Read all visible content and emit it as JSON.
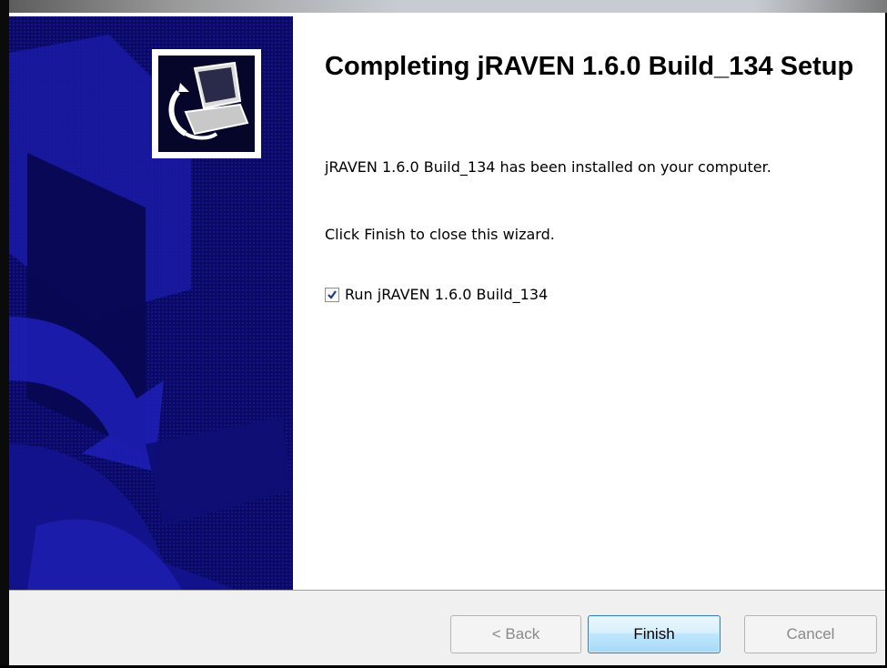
{
  "wizard": {
    "title": "Completing jRAVEN 1.6.0 Build_134 Setup",
    "installed_message": "jRAVEN 1.6.0 Build_134 has been installed on your computer.",
    "close_instruction": "Click Finish to close this wizard.",
    "run_checkbox": {
      "label": "Run jRAVEN 1.6.0 Build_134",
      "checked": true
    }
  },
  "buttons": {
    "back": "< Back",
    "finish": "Finish",
    "cancel": "Cancel"
  },
  "icons": {
    "logo": "installer-computer-icon",
    "side_art": "installer-banner-art"
  },
  "colors": {
    "side_panel": "#0a0a66",
    "finish_border": "#3c7fb1"
  }
}
